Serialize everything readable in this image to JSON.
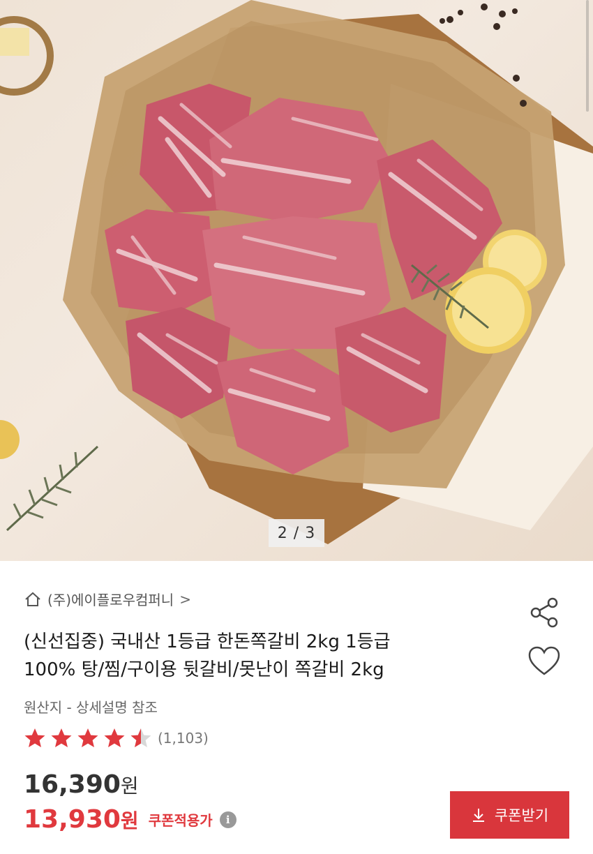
{
  "gallery": {
    "counter": "2 / 3"
  },
  "seller": {
    "name": "(주)에이플로우컴퍼니",
    "chevron": ">"
  },
  "product": {
    "title_line1": "(신선집중) 국내산 1등급 한돈쪽갈비 2kg 1등급",
    "title_line2": "100% 탕/찜/구이용 뒷갈비/못난이 쪽갈비 2kg",
    "origin": "원산지 - 상세설명 참조",
    "rating": 4.5,
    "review_count": "(1,103)"
  },
  "price": {
    "original": "16,390",
    "original_unit": "원",
    "sale": "13,930",
    "sale_unit": "원",
    "coupon_applied_label": "쿠폰적용가",
    "info_glyph": "i"
  },
  "actions": {
    "coupon_button_label": "쿠폰받기",
    "share_icon": "share-icon",
    "like_icon": "heart-icon",
    "download_icon": "download-icon"
  },
  "colors": {
    "accent": "#d9363c",
    "sale_price": "#e0393e",
    "star": "#e0393e",
    "star_empty": "#d8d8d8"
  }
}
